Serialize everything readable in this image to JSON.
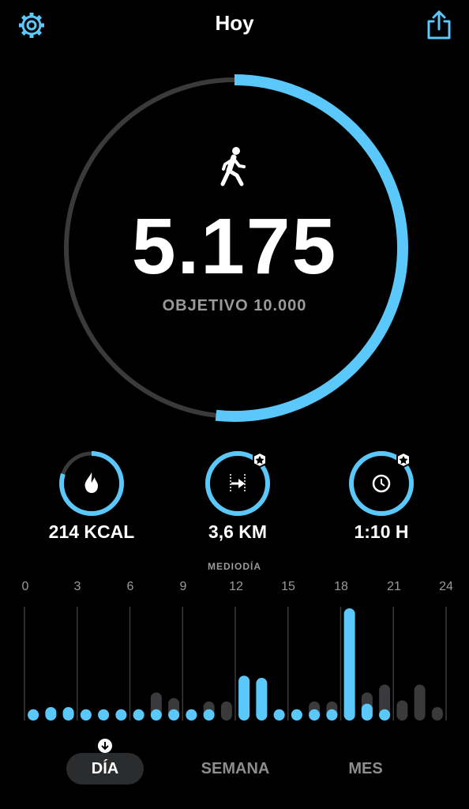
{
  "header": {
    "title": "Hoy",
    "settings_icon": "gear-icon",
    "share_icon": "share-icon"
  },
  "activity": {
    "steps": "5.175",
    "goal_label": "OBJETIVO 10.000",
    "progress_fraction": 0.5175,
    "icon": "walking-person-icon"
  },
  "stats": [
    {
      "label": "214 KCAL",
      "icon": "flame-icon",
      "progress": 0.8,
      "badge": false
    },
    {
      "label": "3,6 KM",
      "icon": "distance-arrow-icon",
      "progress": 1.0,
      "badge": true
    },
    {
      "label": "1:10 H",
      "icon": "clock-icon",
      "progress": 1.0,
      "badge": true
    }
  ],
  "chart_data": {
    "type": "bar",
    "annotation": "MEDIODÍA",
    "x_ticks": [
      "0",
      "3",
      "6",
      "9",
      "12",
      "15",
      "18",
      "21",
      "24"
    ],
    "hours": [
      0,
      1,
      2,
      3,
      4,
      5,
      6,
      7,
      8,
      9,
      10,
      11,
      12,
      13,
      14,
      15,
      16,
      17,
      18,
      19,
      20,
      21,
      22,
      23
    ],
    "today": [
      0.1,
      0.12,
      0.12,
      0.1,
      0.1,
      0.1,
      0.1,
      0.1,
      0.1,
      0.1,
      0.1,
      0,
      0.4,
      0.38,
      0.1,
      0.1,
      0.1,
      0.1,
      1.0,
      0.15,
      0.1,
      0,
      0,
      0
    ],
    "average": [
      0.1,
      0.12,
      0.12,
      0.1,
      0.1,
      0.1,
      0.1,
      0.25,
      0.2,
      0.1,
      0.17,
      0.17,
      0.17,
      0.17,
      0.1,
      0.1,
      0.17,
      0.17,
      0.17,
      0.25,
      0.32,
      0.18,
      0.32,
      0.12
    ],
    "colors": {
      "today": "#5ac8fa",
      "average": "#3a3a3c"
    }
  },
  "tabs": {
    "day": "DÍA",
    "week": "SEMANA",
    "month": "MES",
    "selected_icon": "arrow-down-circle-icon"
  },
  "colors": {
    "accent": "#5ac8fa",
    "track": "#3a3a3c",
    "background": "#000000"
  }
}
